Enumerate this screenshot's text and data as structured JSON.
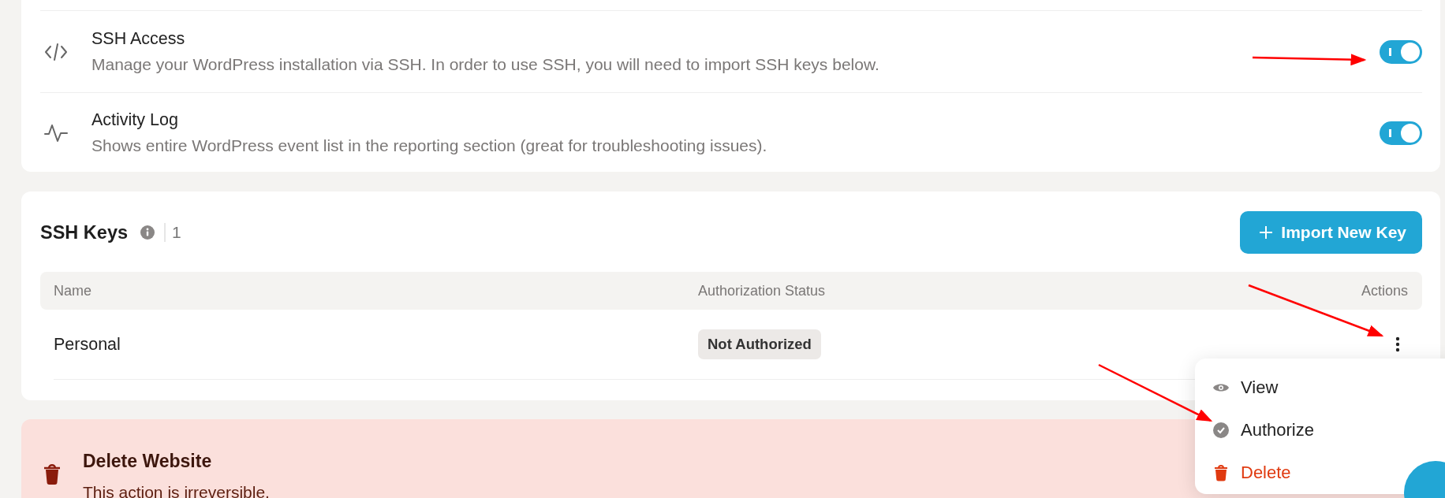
{
  "settings": [
    {
      "kind": "code",
      "title": "SSH Access",
      "description": "Manage your WordPress installation via SSH. In order to use SSH, you will need to import SSH keys below.",
      "on": true
    },
    {
      "kind": "activity",
      "title": "Activity Log",
      "description": "Shows entire WordPress event list in the reporting section (great for troubleshooting issues).",
      "on": true
    }
  ],
  "ssh_keys": {
    "title": "SSH Keys",
    "count": "1",
    "import_button": "Import New Key"
  },
  "table": {
    "columns": [
      "Name",
      "Authorization Status",
      "Actions"
    ],
    "rows": [
      {
        "name": "Personal",
        "status": "Not Authorized"
      }
    ]
  },
  "menu": {
    "items": [
      {
        "kind": "view",
        "label": "View"
      },
      {
        "kind": "authorize",
        "label": "Authorize"
      },
      {
        "kind": "delete",
        "label": "Delete"
      }
    ]
  },
  "danger_zone": {
    "title": "Delete Website",
    "description": "This action is irreversible."
  }
}
